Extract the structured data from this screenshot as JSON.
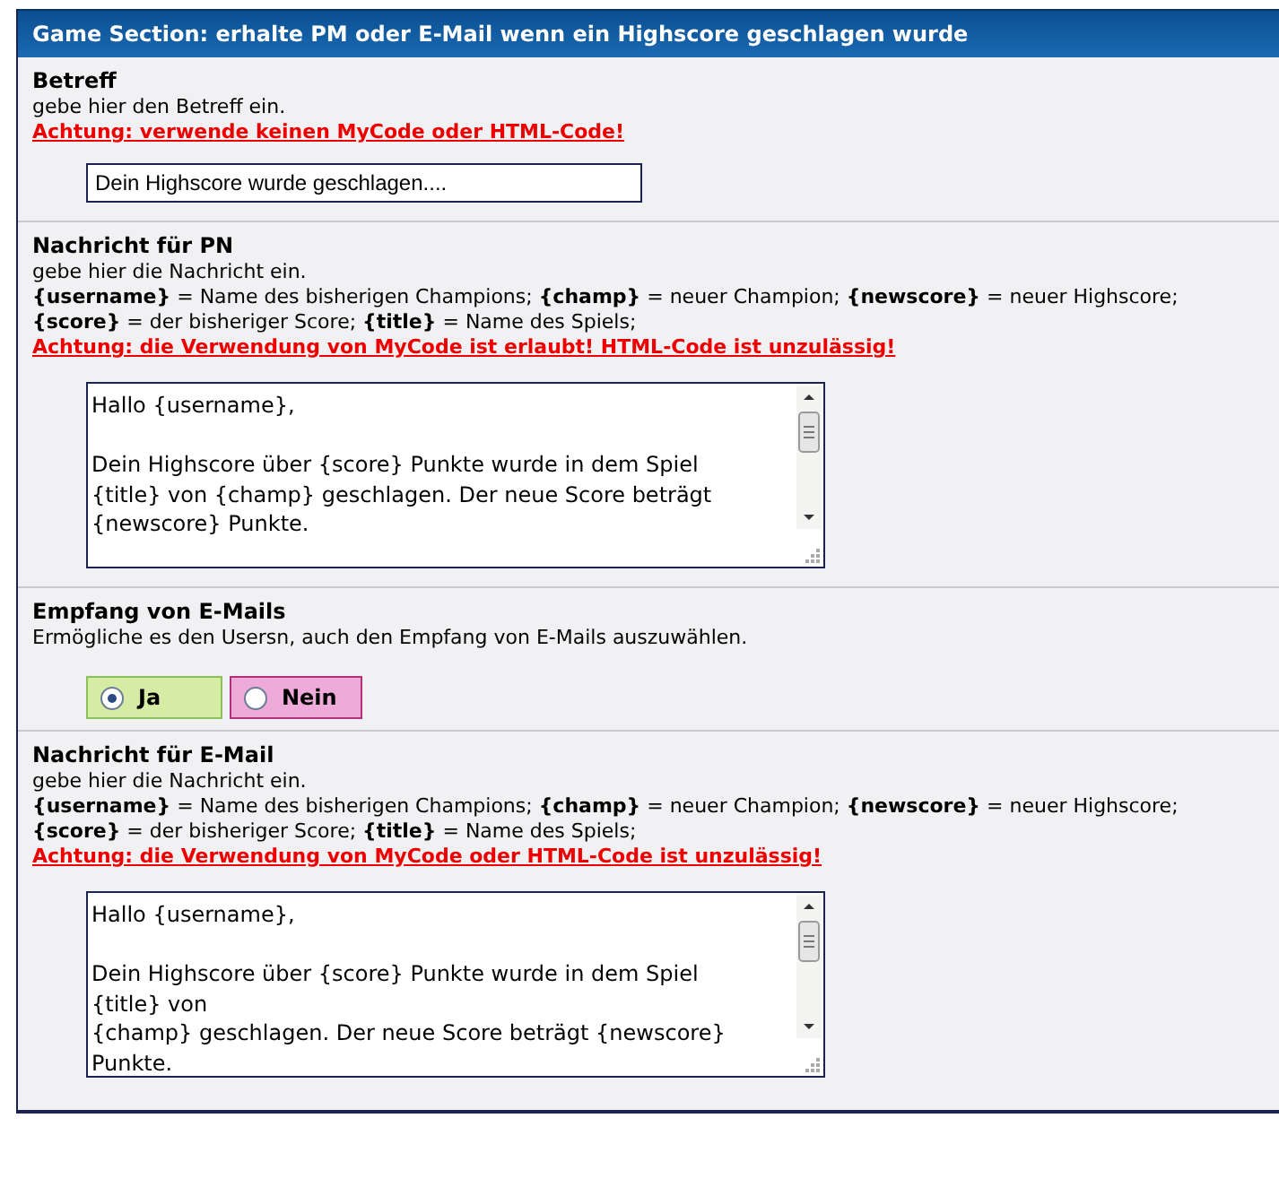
{
  "panel": {
    "title": "Game Section: erhalte PM oder E-Mail wenn ein Highscore geschlagen wurde"
  },
  "settings": [
    {
      "kind": "text",
      "title": "Betreff",
      "description": [
        "gebe hier den Betreff ein."
      ],
      "warning": "Achtung: verwende keinen MyCode oder HTML-Code!",
      "value": "Dein Highscore wurde geschlagen...."
    },
    {
      "kind": "textarea",
      "title": "Nachricht für PN",
      "description": [
        "gebe hier die Nachricht ein.",
        "**{username}** = Name des bisherigen Champions; **{champ}** = neuer Champion; **{newscore}** = neuer Highscore;",
        "**{score}** = der bisheriger Score; **{title}** = Name des Spiels;"
      ],
      "warning": "Achtung: die Verwendung von MyCode ist erlaubt! HTML-Code ist unzulässig!",
      "value": "Hallo {username},\n\nDein Highscore über {score} Punkte wurde in dem Spiel\n{title} von {champ} geschlagen. Der neue Score beträgt\n{newscore} Punkte."
    },
    {
      "kind": "radio",
      "title": "Empfang von E-Mails",
      "description": [
        "Ermögliche es den Usersn, auch den Empfang von E-Mails auszuwählen."
      ],
      "options": [
        {
          "label": "Ja",
          "selected": true,
          "color": "#d6eca4"
        },
        {
          "label": "Nein",
          "selected": false,
          "color": "#eeaad8"
        }
      ]
    },
    {
      "kind": "textarea",
      "title": "Nachricht für E-Mail",
      "description": [
        "gebe hier die Nachricht ein.",
        "**{username}** = Name des bisherigen Champions; **{champ}** = neuer Champion; **{newscore}** = neuer Highscore;",
        "**{score}** = der bisheriger Score; **{title}** = Name des Spiels;"
      ],
      "warning": "Achtung: die Verwendung von MyCode oder HTML-Code ist unzulässig!",
      "value": "Hallo {username},\n\nDein Highscore über {score} Punkte wurde in dem Spiel\n{title} von\n{champ} geschlagen. Der neue Score beträgt {newscore}\nPunkte."
    }
  ]
}
